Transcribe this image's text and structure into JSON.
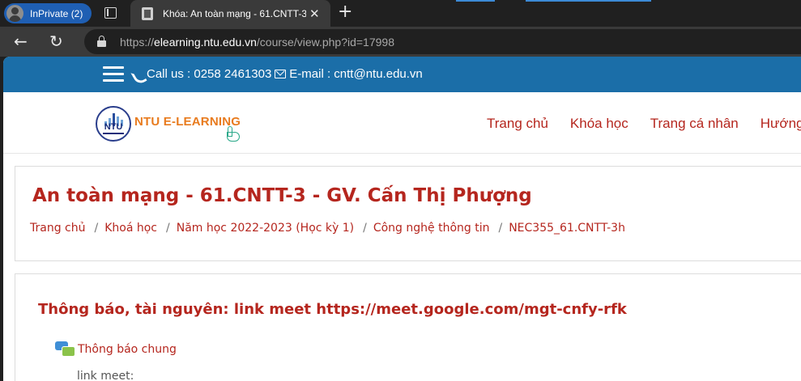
{
  "browser": {
    "profile_label": "InPrivate (2)",
    "tab_title": "Khóa: An toàn mạng - 61.CNTT-3 - GV. Cấn Thị Phượng",
    "tab_close": "✕",
    "new_tab": "+",
    "back": "←",
    "reload": "↻",
    "url_host": "elearning.ntu.edu.vn",
    "url_prefix": "https://",
    "url_path": "/course/view.php?id=17998"
  },
  "site": {
    "contact_text": "Call us : 0258 2461303",
    "email_text": "E-mail : cntt@ntu.edu.vn",
    "logo_text": "NTU E-LEARNING",
    "logo_mark": "NTU",
    "menu": [
      {
        "label": "Trang chủ"
      },
      {
        "label": "Khóa học"
      },
      {
        "label": "Trang cá nhân"
      },
      {
        "label": "Hướng"
      }
    ]
  },
  "course": {
    "title": "An toàn mạng - 61.CNTT-3 - GV. Cấn Thị Phượng",
    "breadcrumb": [
      {
        "label": "Trang chủ"
      },
      {
        "label": "Khoá học"
      },
      {
        "label": "Năm học 2022-2023 (Học kỳ 1)"
      },
      {
        "label": "Công nghệ thông tin"
      },
      {
        "label": "NEC355_61.CNTT-3h"
      }
    ],
    "breadcrumb_sep": "/"
  },
  "section": {
    "title": "Thông báo, tài nguyên: link meet https://meet.google.com/mgt-cnfy-rfk",
    "forum_label": "Thông báo chung",
    "forum_text": "link meet:"
  },
  "colors": {
    "accent": "#b5261e",
    "contact_bar": "#1b6ea8",
    "logo_orange": "#e87b1e"
  }
}
